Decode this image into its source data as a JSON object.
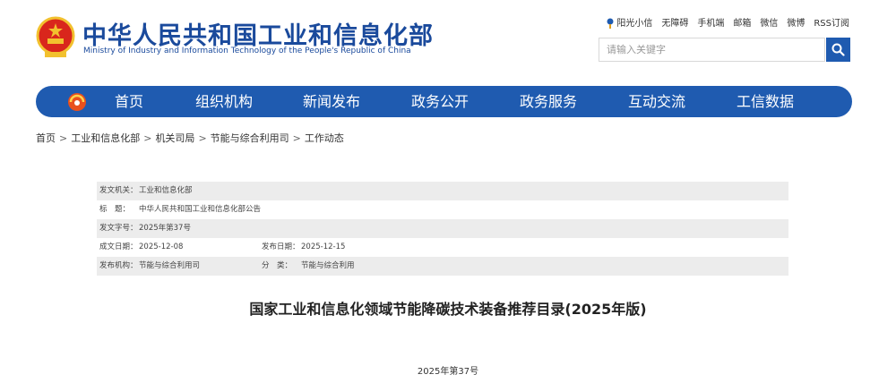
{
  "header": {
    "title": "中华人民共和国工业和信息化部",
    "subtitle": "Ministry of Industry and Information Technology of the People's Republic of China",
    "top_links": [
      "阳光小信",
      "无障碍",
      "手机端",
      "邮箱",
      "微信",
      "微博",
      "RSS订阅"
    ],
    "search": {
      "placeholder": "请输入关键字",
      "value": ""
    }
  },
  "nav": {
    "items": [
      "首页",
      "组织机构",
      "新闻发布",
      "政务公开",
      "政务服务",
      "互动交流",
      "工信数据"
    ]
  },
  "breadcrumb": [
    "首页",
    "工业和信息化部",
    "机关司局",
    "节能与综合利用司",
    "工作动态"
  ],
  "meta": {
    "issuer_label": "发文机关：",
    "issuer": "工业和信息化部",
    "title_label": "标　题：",
    "title": "中华人民共和国工业和信息化部公告",
    "doc_no_label": "发文字号：",
    "doc_no": "2025年第37号",
    "created_label": "成文日期：",
    "created": "2025-12-08",
    "published_label": "发布日期：",
    "published": "2025-12-15",
    "agency_label": "发布机构：",
    "agency": "节能与综合利用司",
    "category_label": "分　类：",
    "category": "节能与综合利用"
  },
  "document": {
    "heading": "国家工业和信息化领域节能降碳技术装备推荐目录(2025年版)",
    "number": "2025年第37号"
  },
  "colors": {
    "brand": "#1f5bb0",
    "title": "#1a4a9c",
    "row_shade": "#ececec"
  }
}
